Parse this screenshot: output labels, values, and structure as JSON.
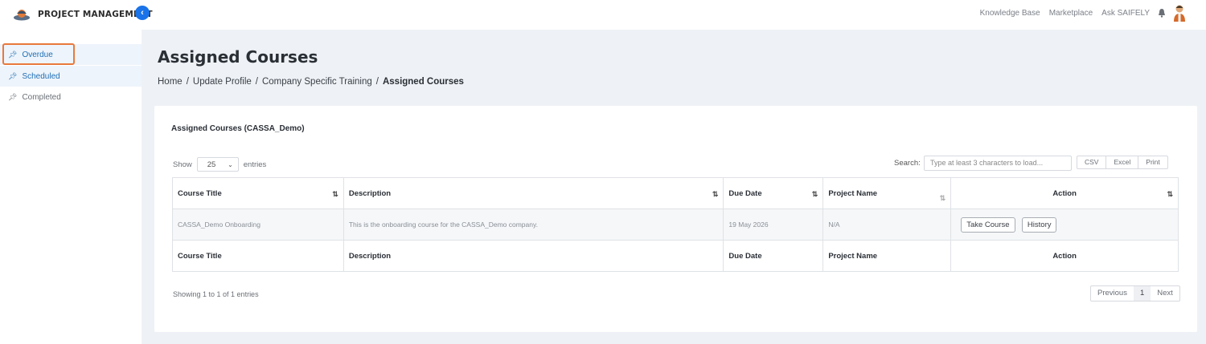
{
  "app": {
    "brand": "PROJECT MANAGEMENT"
  },
  "topnav": [
    "Knowledge Base",
    "Marketplace",
    "Ask SAIFELY"
  ],
  "sidebar": {
    "items": [
      {
        "label": "Overdue"
      },
      {
        "label": "Scheduled"
      },
      {
        "label": "Completed"
      }
    ]
  },
  "page": {
    "title": "Assigned Courses",
    "breadcrumb": [
      "Home",
      "Update Profile",
      "Company Specific Training",
      "Assigned Courses"
    ]
  },
  "card": {
    "title": "Assigned Courses (CASSA_Demo)",
    "show_label": "Show",
    "entries_value": "25",
    "entries_label": "entries",
    "search_label": "Search:",
    "search_placeholder": "Type at least 3 characters to load...",
    "exports": [
      "CSV",
      "Excel",
      "Print"
    ]
  },
  "table": {
    "headers": [
      "Course Title",
      "Description",
      "Due Date",
      "Project Name",
      "Action"
    ],
    "rows": [
      {
        "course_title": "CASSA_Demo Onboarding",
        "description": "This is the onboarding course for the CASSA_Demo company.",
        "due_date": "19 May 2026",
        "project_name": "N/A",
        "actions": [
          "Take Course",
          "History"
        ]
      }
    ],
    "footers": [
      "Course Title",
      "Description",
      "Due Date",
      "Project Name",
      "Action"
    ]
  },
  "pagination": {
    "info": "Showing 1 to 1 of 1 entries",
    "previous": "Previous",
    "page": "1",
    "next": "Next"
  },
  "colors": {
    "accent": "#1a73e8",
    "highlight": "#e8793d",
    "main_bg": "#eef2f6"
  }
}
